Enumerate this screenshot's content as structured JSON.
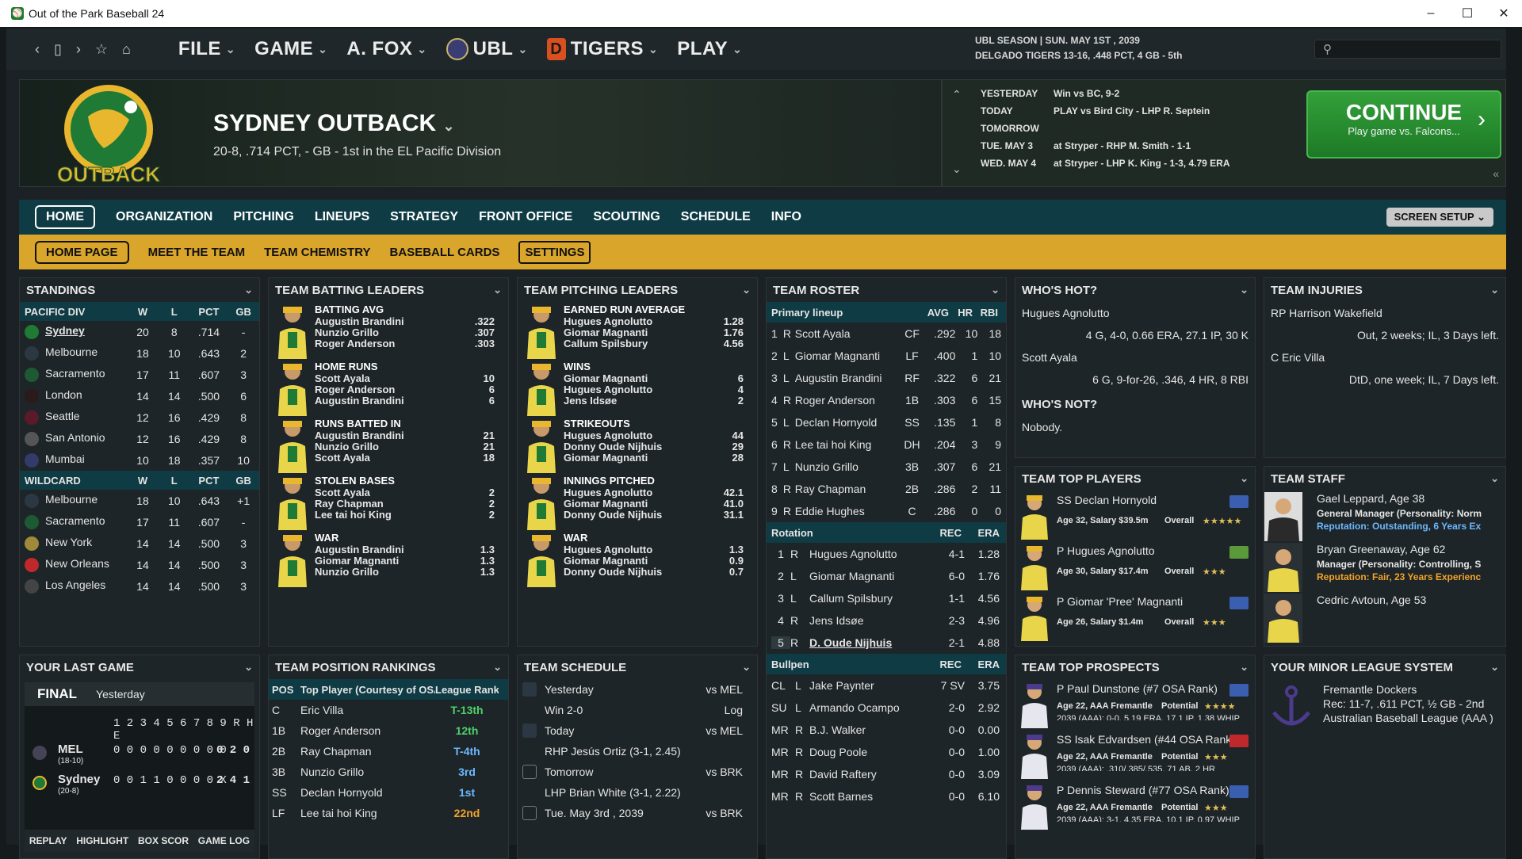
{
  "window": {
    "title": "Out of the Park Baseball 24"
  },
  "topnav": {
    "menus": [
      "FILE",
      "GAME",
      "A. FOX",
      "UBL",
      "TIGERS",
      "PLAY"
    ],
    "season_line1": "UBL SEASON  |  SUN. MAY 1ST , 2039",
    "season_line2": "DELGADO TIGERS  13-16, .448 PCT, 4 GB - 5th"
  },
  "team": {
    "name": "SYDNEY OUTBACK",
    "record": "20-8, .714 PCT, - GB - 1st in the EL Pacific Division",
    "logo_text": "OUTBACK"
  },
  "schedule_header": {
    "rows": [
      {
        "day": "YESTERDAY",
        "text": "Win vs BC, 9-2"
      },
      {
        "day": "TODAY",
        "text": "PLAY vs Bird City - LHP R. Septein"
      },
      {
        "day": "TOMORROW",
        "text": ""
      },
      {
        "day": "TUE. MAY 3",
        "text": "at Stryper - RHP M. Smith - 1-1"
      },
      {
        "day": "WED. MAY 4",
        "text": "at Stryper - LHP K. King - 1-3, 4.79 ERA"
      }
    ]
  },
  "continue": {
    "label": "CONTINUE",
    "sub": "Play game vs. Falcons..."
  },
  "tabs": {
    "main": [
      "HOME",
      "ORGANIZATION",
      "PITCHING",
      "LINEUPS",
      "STRATEGY",
      "FRONT OFFICE",
      "SCOUTING",
      "SCHEDULE",
      "INFO"
    ],
    "screen_setup": "SCREEN SETUP",
    "sub": [
      "HOME PAGE",
      "MEET THE TEAM",
      "TEAM CHEMISTRY",
      "BASEBALL CARDS",
      "SETTINGS"
    ]
  },
  "standings": {
    "title": "STANDINGS",
    "headers": [
      "PACIFIC DIV",
      "W",
      "L",
      "PCT",
      "GB"
    ],
    "rows": [
      [
        "Sydney",
        "20",
        "8",
        ".714",
        "-"
      ],
      [
        "Melbourne",
        "18",
        "10",
        ".643",
        "2"
      ],
      [
        "Sacramento",
        "17",
        "11",
        ".607",
        "3"
      ],
      [
        "London",
        "14",
        "14",
        ".500",
        "6"
      ],
      [
        "Seattle",
        "12",
        "16",
        ".429",
        "8"
      ],
      [
        "San Antonio",
        "12",
        "16",
        ".429",
        "8"
      ],
      [
        "Mumbai",
        "10",
        "18",
        ".357",
        "10"
      ]
    ],
    "wc_headers": [
      "WILDCARD",
      "W",
      "L",
      "PCT",
      "GB"
    ],
    "wc_rows": [
      [
        "Melbourne",
        "18",
        "10",
        ".643",
        "+1"
      ],
      [
        "Sacramento",
        "17",
        "11",
        ".607",
        "-"
      ],
      [
        "New York",
        "14",
        "14",
        ".500",
        "3"
      ],
      [
        "New Orleans",
        "14",
        "14",
        ".500",
        "3"
      ],
      [
        "Los Angeles",
        "14",
        "14",
        ".500",
        "3"
      ]
    ]
  },
  "batting": {
    "title": "TEAM BATTING LEADERS",
    "cats": [
      {
        "cat": "BATTING AVG",
        "p": [
          [
            "Augustin Brandini",
            ".322"
          ],
          [
            "Nunzio Grillo",
            ".307"
          ],
          [
            "Roger Anderson",
            ".303"
          ]
        ]
      },
      {
        "cat": "HOME RUNS",
        "p": [
          [
            "Scott Ayala",
            "10"
          ],
          [
            "Roger Anderson",
            "6"
          ],
          [
            "Augustin Brandini",
            "6"
          ]
        ]
      },
      {
        "cat": "RUNS BATTED IN",
        "p": [
          [
            "Augustin Brandini",
            "21"
          ],
          [
            "Nunzio Grillo",
            "21"
          ],
          [
            "Scott Ayala",
            "18"
          ]
        ]
      },
      {
        "cat": "STOLEN BASES",
        "p": [
          [
            "Scott Ayala",
            "2"
          ],
          [
            "Ray Chapman",
            "2"
          ],
          [
            "Lee tai hoi King",
            "2"
          ]
        ]
      },
      {
        "cat": "WAR",
        "p": [
          [
            "Augustin Brandini",
            "1.3"
          ],
          [
            "Giomar Magnanti",
            "1.3"
          ],
          [
            "Nunzio Grillo",
            "1.3"
          ]
        ]
      }
    ]
  },
  "pitching": {
    "title": "TEAM PITCHING LEADERS",
    "cats": [
      {
        "cat": "EARNED RUN AVERAGE",
        "p": [
          [
            "Hugues Agnolutto",
            "1.28"
          ],
          [
            "Giomar Magnanti",
            "1.76"
          ],
          [
            "Callum Spilsbury",
            "4.56"
          ]
        ]
      },
      {
        "cat": "WINS",
        "p": [
          [
            "Giomar Magnanti",
            "6"
          ],
          [
            "Hugues Agnolutto",
            "4"
          ],
          [
            "Jens Idsøe",
            "2"
          ]
        ]
      },
      {
        "cat": "STRIKEOUTS",
        "p": [
          [
            "Hugues Agnolutto",
            "44"
          ],
          [
            "Donny Oude Nijhuis",
            "29"
          ],
          [
            "Giomar Magnanti",
            "28"
          ]
        ]
      },
      {
        "cat": "INNINGS PITCHED",
        "p": [
          [
            "Hugues Agnolutto",
            "42.1"
          ],
          [
            "Giomar Magnanti",
            "41.0"
          ],
          [
            "Donny Oude Nijhuis",
            "31.1"
          ]
        ]
      },
      {
        "cat": "WAR",
        "p": [
          [
            "Hugues Agnolutto",
            "1.3"
          ],
          [
            "Giomar Magnanti",
            "0.9"
          ],
          [
            "Donny Oude Nijhuis",
            "0.7"
          ]
        ]
      }
    ]
  },
  "roster": {
    "title": "TEAM ROSTER",
    "lineup_head": [
      "Primary lineup",
      "AVG",
      "HR",
      "RBI"
    ],
    "lineup": [
      [
        "1",
        "R",
        "Scott Ayala",
        "CF",
        ".292",
        "10",
        "18"
      ],
      [
        "2",
        "L",
        "Giomar Magnanti",
        "LF",
        ".400",
        "1",
        "10"
      ],
      [
        "3",
        "L",
        "Augustin Brandini",
        "RF",
        ".322",
        "6",
        "21"
      ],
      [
        "4",
        "R",
        "Roger Anderson",
        "1B",
        ".303",
        "6",
        "15"
      ],
      [
        "5",
        "L",
        "Declan Hornyold",
        "SS",
        ".135",
        "1",
        "8"
      ],
      [
        "6",
        "R",
        "Lee tai hoi King",
        "DH",
        ".204",
        "3",
        "9"
      ],
      [
        "7",
        "L",
        "Nunzio Grillo",
        "3B",
        ".307",
        "6",
        "21"
      ],
      [
        "8",
        "R",
        "Ray Chapman",
        "2B",
        ".286",
        "2",
        "11"
      ],
      [
        "9",
        "R",
        "Eddie Hughes",
        "C",
        ".286",
        "0",
        "0"
      ]
    ],
    "rot_head": [
      "Rotation",
      "REC",
      "ERA"
    ],
    "rotation": [
      [
        "1",
        "R",
        "Hugues Agnolutto",
        "4-1",
        "1.28"
      ],
      [
        "2",
        "L",
        "Giomar Magnanti",
        "6-0",
        "1.76"
      ],
      [
        "3",
        "L",
        "Callum Spilsbury",
        "1-1",
        "4.56"
      ],
      [
        "4",
        "R",
        "Jens Idsøe",
        "2-3",
        "4.96"
      ],
      [
        "5",
        "R",
        "D. Oude Nijhuis",
        "2-1",
        "4.88"
      ]
    ],
    "pen_head": [
      "Bullpen",
      "REC",
      "ERA"
    ],
    "bullpen": [
      [
        "CL",
        "L",
        "Jake Paynter",
        "7 SV",
        "3.75"
      ],
      [
        "SU",
        "L",
        "Armando Ocampo",
        "2-0",
        "2.92"
      ],
      [
        "MR",
        "R",
        "B.J. Walker",
        "0-0",
        "0.00"
      ],
      [
        "MR",
        "R",
        "Doug Poole",
        "0-0",
        "1.00"
      ],
      [
        "MR",
        "R",
        "David Raftery",
        "0-0",
        "3.09"
      ],
      [
        "MR",
        "R",
        "Scott Barnes",
        "0-0",
        "6.10"
      ]
    ]
  },
  "hot": {
    "title": "WHO'S HOT?",
    "items": [
      {
        "name": "Hugues Agnolutto",
        "line": "4 G, 4-0, 0.66 ERA, 27.1 IP, 30 K"
      },
      {
        "name": "Scott Ayala",
        "line": "6 G, 9-for-26, .346, 4 HR, 8 RBI"
      }
    ],
    "not_title": "WHO'S NOT?",
    "not_text": "Nobody."
  },
  "injuries": {
    "title": "TEAM INJURIES",
    "items": [
      {
        "name": "RP Harrison Wakefield",
        "line": "Out, 2 weeks; IL, 3 Days left."
      },
      {
        "name": "C Eric Villa",
        "line": "DtD, one week; IL, 7 Days left."
      }
    ]
  },
  "top_players": {
    "title": "TEAM TOP PLAYERS",
    "items": [
      {
        "name": "SS Declan Hornyold",
        "info": "Age 32, Salary $39.5m",
        "label": "Overall",
        "stars": "★★★★★"
      },
      {
        "name": "P Hugues Agnolutto",
        "info": "Age 30, Salary $17.4m",
        "label": "Overall",
        "stars": "★★★"
      },
      {
        "name": "P Giomar 'Pree' Magnanti",
        "info": "Age 26, Salary $1.4m",
        "label": "Overall",
        "stars": "★★★"
      }
    ]
  },
  "staff": {
    "title": "TEAM STAFF",
    "items": [
      {
        "name": "Gael Leppard, Age 38",
        "role": "General Manager (Personality: Norm",
        "rep": "Reputation: Outstanding, 6 Years Ex"
      },
      {
        "name": "Bryan Greenaway, Age 62",
        "role": "Manager (Personality: Controlling, S",
        "rep": "Reputation: Fair, 23 Years Experienc"
      },
      {
        "name": "Cedric Avtoun, Age 53",
        "role": "",
        "rep": ""
      }
    ]
  },
  "last_game": {
    "title": "YOUR LAST GAME",
    "final": "FINAL",
    "when": "Yesterday",
    "innings": "1 2 3 4 5 6 7 8 9  R H E",
    "teams": [
      {
        "abbr": "MEL",
        "rec": "(18-10)",
        "line": "0 0 0 0 0 0 0 0 0",
        "rhe": "0 2 0"
      },
      {
        "abbr": "Sydney",
        "rec": "(20-8)",
        "line": "0 0 1 1 0 0 0 0 X",
        "rhe": "2 4 1"
      }
    ],
    "buttons": [
      "REPLAY",
      "HIGHLIGHT",
      "BOX SCOR",
      "GAME LOG"
    ]
  },
  "positions": {
    "title": "TEAM POSITION RANKINGS",
    "headers": [
      "POS",
      "Top Player (Courtesy of OSA)",
      "League Rank"
    ],
    "rows": [
      [
        "C",
        "Eric Villa",
        "T-13th"
      ],
      [
        "1B",
        "Roger Anderson",
        "12th"
      ],
      [
        "2B",
        "Ray Chapman",
        "T-4th"
      ],
      [
        "3B",
        "Nunzio Grillo",
        "3rd"
      ],
      [
        "SS",
        "Declan Hornyold",
        "1st"
      ],
      [
        "LF",
        "Lee tai hoi King",
        "22nd"
      ]
    ]
  },
  "team_schedule": {
    "title": "TEAM SCHEDULE",
    "rows": [
      {
        "day": "Yesterday",
        "opp": "vs MEL"
      },
      {
        "day": "Win 2-0",
        "opp": "Log"
      },
      {
        "day": "Today",
        "opp": "vs MEL"
      },
      {
        "day": "RHP Jesús Ortiz (3-1, 2.45)",
        "opp": ""
      },
      {
        "day": "Tomorrow",
        "opp": "vs BRK"
      },
      {
        "day": "LHP Brian White (3-1, 2.22)",
        "opp": ""
      },
      {
        "day": "Tue. May 3rd , 2039",
        "opp": "vs BRK"
      }
    ]
  },
  "prospects": {
    "title": "TEAM TOP PROSPECTS",
    "items": [
      {
        "name": "P Paul Dunstone (#7 OSA Rank)",
        "info": "Age 22, AAA Fremantle",
        "label": "Potential",
        "stars": "★★★★",
        "stat": "2039 (AAA): 0-0, 5.19 ERA, 17.1 IP, 1.38 WHIP"
      },
      {
        "name": "SS Isak Edvardsen (#44 OSA Rank)",
        "info": "Age 22, AAA Fremantle",
        "label": "Potential",
        "stars": "★★★",
        "stat": "2039 (AAA): .310/.385/.535, 71 AB, 2 HR"
      },
      {
        "name": "P Dennis Steward (#77 OSA Rank)",
        "info": "Age 22, AAA Fremantle",
        "label": "Potential",
        "stars": "★★★",
        "stat": "2039 (AAA): 3-1, 4.35 ERA, 10.1 IP, 0.97 WHIP"
      }
    ]
  },
  "minors": {
    "title": "YOUR MINOR LEAGUE SYSTEM",
    "team": "Fremantle Dockers",
    "rec": "Rec: 11-7, .611 PCT, ½ GB - 2nd",
    "league": "Australian Baseball League (AAA )"
  }
}
